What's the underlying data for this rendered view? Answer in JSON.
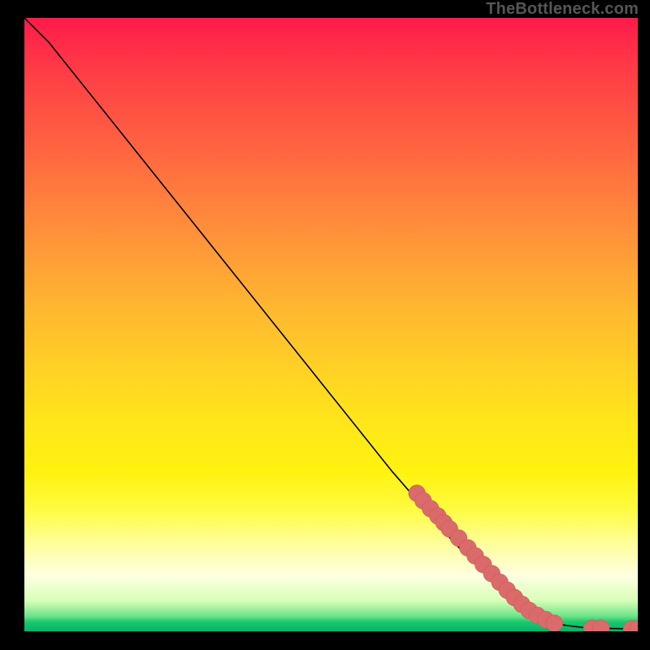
{
  "watermark": "TheBottleneck.com",
  "colors": {
    "marker_fill": "#db6a6a",
    "marker_stroke": "#c55a5a",
    "line": "#000000"
  },
  "chart_data": {
    "type": "line",
    "title": "",
    "xlabel": "",
    "ylabel": "",
    "xlim": [
      0,
      100
    ],
    "ylim": [
      0,
      100
    ],
    "curve": [
      {
        "x": 0,
        "y": 100
      },
      {
        "x": 4,
        "y": 96
      },
      {
        "x": 8,
        "y": 91
      },
      {
        "x": 12,
        "y": 86
      },
      {
        "x": 20,
        "y": 76
      },
      {
        "x": 30,
        "y": 63.5
      },
      {
        "x": 40,
        "y": 51
      },
      {
        "x": 50,
        "y": 38.5
      },
      {
        "x": 60,
        "y": 26
      },
      {
        "x": 70,
        "y": 14.5
      },
      {
        "x": 78,
        "y": 6.5
      },
      {
        "x": 84,
        "y": 2.5
      },
      {
        "x": 88,
        "y": 1.0
      },
      {
        "x": 92,
        "y": 0.5
      },
      {
        "x": 100,
        "y": 0.4
      }
    ],
    "markers": [
      {
        "x": 64.0,
        "y": 22.5,
        "r": 1.3
      },
      {
        "x": 65.0,
        "y": 21.3,
        "r": 1.3
      },
      {
        "x": 66.2,
        "y": 20.0,
        "r": 1.3
      },
      {
        "x": 67.4,
        "y": 18.8,
        "r": 1.3
      },
      {
        "x": 68.4,
        "y": 17.7,
        "r": 1.3
      },
      {
        "x": 69.3,
        "y": 16.7,
        "r": 1.3
      },
      {
        "x": 70.8,
        "y": 15.2,
        "r": 1.3
      },
      {
        "x": 72.3,
        "y": 13.6,
        "r": 1.3
      },
      {
        "x": 73.5,
        "y": 12.3,
        "r": 1.3
      },
      {
        "x": 74.8,
        "y": 10.9,
        "r": 1.3
      },
      {
        "x": 76.2,
        "y": 9.4,
        "r": 1.3
      },
      {
        "x": 77.5,
        "y": 8.0,
        "r": 1.3
      },
      {
        "x": 78.7,
        "y": 6.7,
        "r": 1.3
      },
      {
        "x": 79.9,
        "y": 5.5,
        "r": 1.3
      },
      {
        "x": 81.1,
        "y": 4.4,
        "r": 1.3
      },
      {
        "x": 82.3,
        "y": 3.4,
        "r": 1.3
      },
      {
        "x": 83.6,
        "y": 2.6,
        "r": 1.3
      },
      {
        "x": 85.0,
        "y": 1.9,
        "r": 1.3
      },
      {
        "x": 86.4,
        "y": 1.3,
        "r": 1.3
      },
      {
        "x": 92.5,
        "y": 0.5,
        "r": 1.3
      },
      {
        "x": 94.0,
        "y": 0.5,
        "r": 1.3
      },
      {
        "x": 99.0,
        "y": 0.4,
        "r": 1.3
      },
      {
        "x": 100.0,
        "y": 0.4,
        "r": 1.3
      }
    ]
  }
}
